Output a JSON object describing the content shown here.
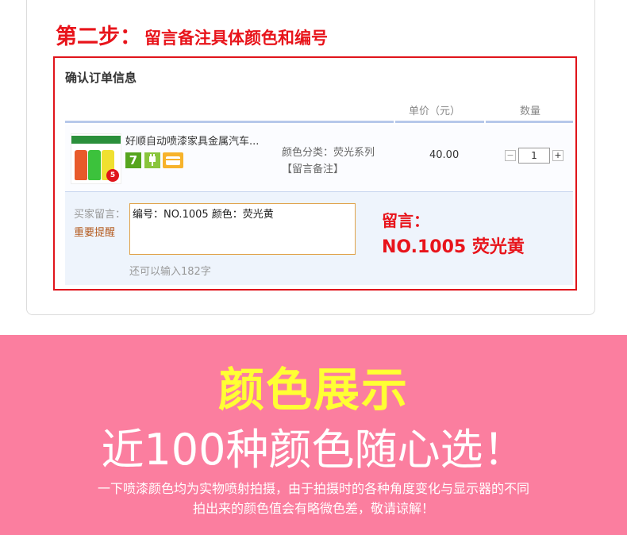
{
  "step": {
    "label": "第二步：",
    "text": "留言备注具体颜色和编号"
  },
  "order": {
    "heading": "确认订单信息",
    "columns": {
      "price": "单价（元）",
      "qty": "数量"
    },
    "item": {
      "title": "好顺自动喷漆家具金属汽车...",
      "attr_label": "颜色分类：荧光系列",
      "attr_note": "【留言备注】",
      "price": "40.00",
      "qty": "1",
      "qty_minus": "−",
      "qty_plus": "+",
      "thumb_badge": "5",
      "icon_seven": "7"
    },
    "message": {
      "label": "买家留言：",
      "remind": "重要提醒",
      "value": "编号：NO.1005 颜色：荧光黄",
      "char_left": "还可以输入182字"
    },
    "note": {
      "line1": "留言：",
      "line2": "NO.1005 荧光黄"
    }
  },
  "banner": {
    "title": "颜色展示",
    "subtitle": "近100种颜色随心选！",
    "note_line1": "一下喷漆颜色均为实物喷射拍摄，由于拍摄时的各种角度变化与显示器的不同",
    "note_line2": "拍出来的颜色值会有略微色差，敬请谅解！"
  },
  "colors": {
    "accent_red": "#e8141b",
    "banner_pink": "#fb7e9f",
    "banner_yellow": "#ffff33"
  }
}
